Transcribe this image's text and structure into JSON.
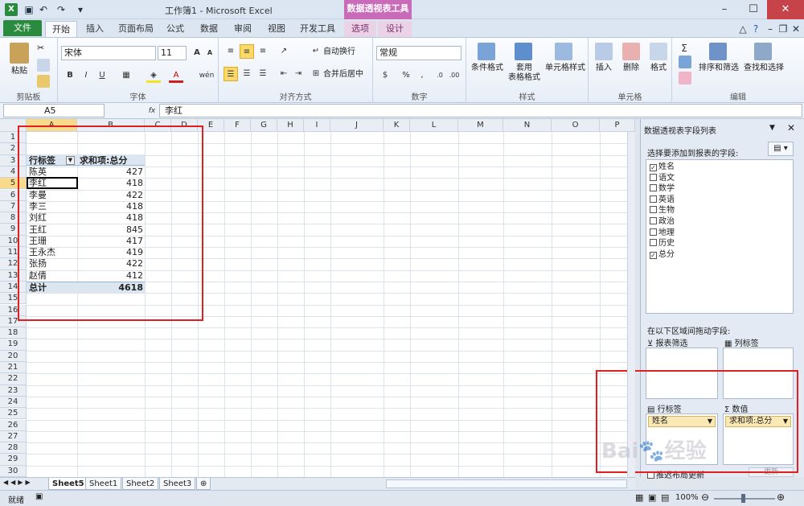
{
  "window": {
    "title": "工作簿1 - Microsoft Excel",
    "context_tools": "数据透视表工具"
  },
  "tabs": [
    "文件",
    "开始",
    "插入",
    "页面布局",
    "公式",
    "数据",
    "审阅",
    "视图",
    "开发工具",
    "选项",
    "设计"
  ],
  "ribbon": {
    "clipboard": {
      "paste": "粘贴",
      "label": "剪贴板"
    },
    "font": {
      "name": "宋体",
      "size": "11",
      "label": "字体",
      "bold": "B",
      "italic": "I",
      "underline": "U",
      "wen": "wén"
    },
    "alignment": {
      "wrap": "自动换行",
      "merge": "合并后居中",
      "label": "对齐方式"
    },
    "number": {
      "format": "常规",
      "percent": "%",
      "comma": ",",
      "label": "数字"
    },
    "styles": {
      "conditional": "条件格式",
      "table_l1": "套用",
      "table_l2": "表格格式",
      "cell_styles": "单元格样式",
      "label": "样式"
    },
    "cells": {
      "insert": "插入",
      "delete": "删除",
      "format": "格式",
      "label": "单元格"
    },
    "editing": {
      "sort": "排序和筛选",
      "find": "查找和选择",
      "label": "编辑",
      "sigma": "Σ"
    }
  },
  "formula_bar": {
    "name_box": "A5",
    "fx": "fx",
    "value": "李红"
  },
  "columns": [
    "A",
    "B",
    "C",
    "D",
    "E",
    "F",
    "G",
    "H",
    "I",
    "J",
    "K",
    "L",
    "M",
    "N",
    "O",
    "P"
  ],
  "rows": [
    "1",
    "2",
    "3",
    "4",
    "5",
    "6",
    "7",
    "8",
    "9",
    "10",
    "11",
    "12",
    "13",
    "14",
    "15",
    "16",
    "17",
    "18",
    "19",
    "20",
    "21",
    "22",
    "23",
    "24",
    "25",
    "26",
    "27",
    "28",
    "29",
    "30"
  ],
  "pivot": {
    "header_row": "行标签",
    "header_value": "求和项:总分",
    "rows": [
      {
        "name": "陈英",
        "value": "427"
      },
      {
        "name": "李红",
        "value": "418"
      },
      {
        "name": "李曼",
        "value": "422"
      },
      {
        "name": "李三",
        "value": "418"
      },
      {
        "name": "刘红",
        "value": "418"
      },
      {
        "name": "王红",
        "value": "845"
      },
      {
        "name": "王珊",
        "value": "417"
      },
      {
        "name": "王永杰",
        "value": "419"
      },
      {
        "name": "张扬",
        "value": "422"
      },
      {
        "name": "赵倩",
        "value": "412"
      }
    ],
    "total_label": "总计",
    "total_value": "4618"
  },
  "pane": {
    "title": "数据透视表字段列表",
    "choose_label": "选择要添加到报表的字段:",
    "fields": [
      {
        "name": "姓名",
        "checked": "✓"
      },
      {
        "name": "语文",
        "checked": ""
      },
      {
        "name": "数学",
        "checked": ""
      },
      {
        "name": "英语",
        "checked": ""
      },
      {
        "name": "生物",
        "checked": ""
      },
      {
        "name": "政治",
        "checked": ""
      },
      {
        "name": "地理",
        "checked": ""
      },
      {
        "name": "历史",
        "checked": ""
      },
      {
        "name": "总分",
        "checked": "✓"
      }
    ],
    "drag_label": "在以下区域间拖动字段:",
    "report_filter": "报表筛选",
    "column_labels": "列标签",
    "row_labels": "行标签",
    "values": "数值",
    "row_chip": "姓名",
    "value_chip": "求和项:总分",
    "defer_label": "推迟布局更新",
    "update_btn": "更新"
  },
  "sheets": [
    "Sheet5",
    "Sheet1",
    "Sheet2",
    "Sheet3"
  ],
  "status": {
    "ready": "就绪",
    "zoom": "100%"
  },
  "watermark": "Bai 经验"
}
